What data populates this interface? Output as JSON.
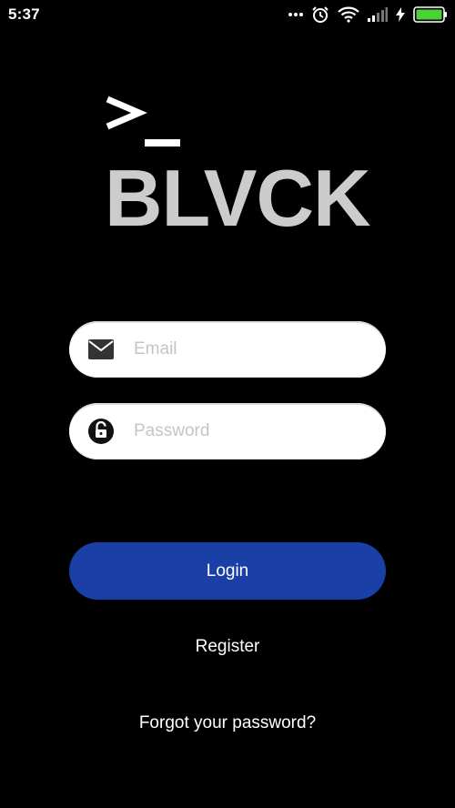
{
  "status_bar": {
    "time": "5:37",
    "icons": [
      "more-dots-icon",
      "alarm-clock-icon",
      "wifi-icon",
      "cell-signal-icon",
      "charging-bolt-icon",
      "battery-icon"
    ],
    "battery_color": "#4cd137"
  },
  "logo": {
    "prompt": ">_",
    "name": "BLVCK",
    "color": "#cccccc"
  },
  "email": {
    "placeholder": "Email",
    "value": "",
    "icon": "envelope-icon"
  },
  "password": {
    "placeholder": "Password",
    "value": "",
    "icon": "unlock-icon"
  },
  "login": {
    "label": "Login",
    "color": "#1a3fa6"
  },
  "register": {
    "label": "Register"
  },
  "forgot": {
    "label": "Forgot your password?"
  }
}
